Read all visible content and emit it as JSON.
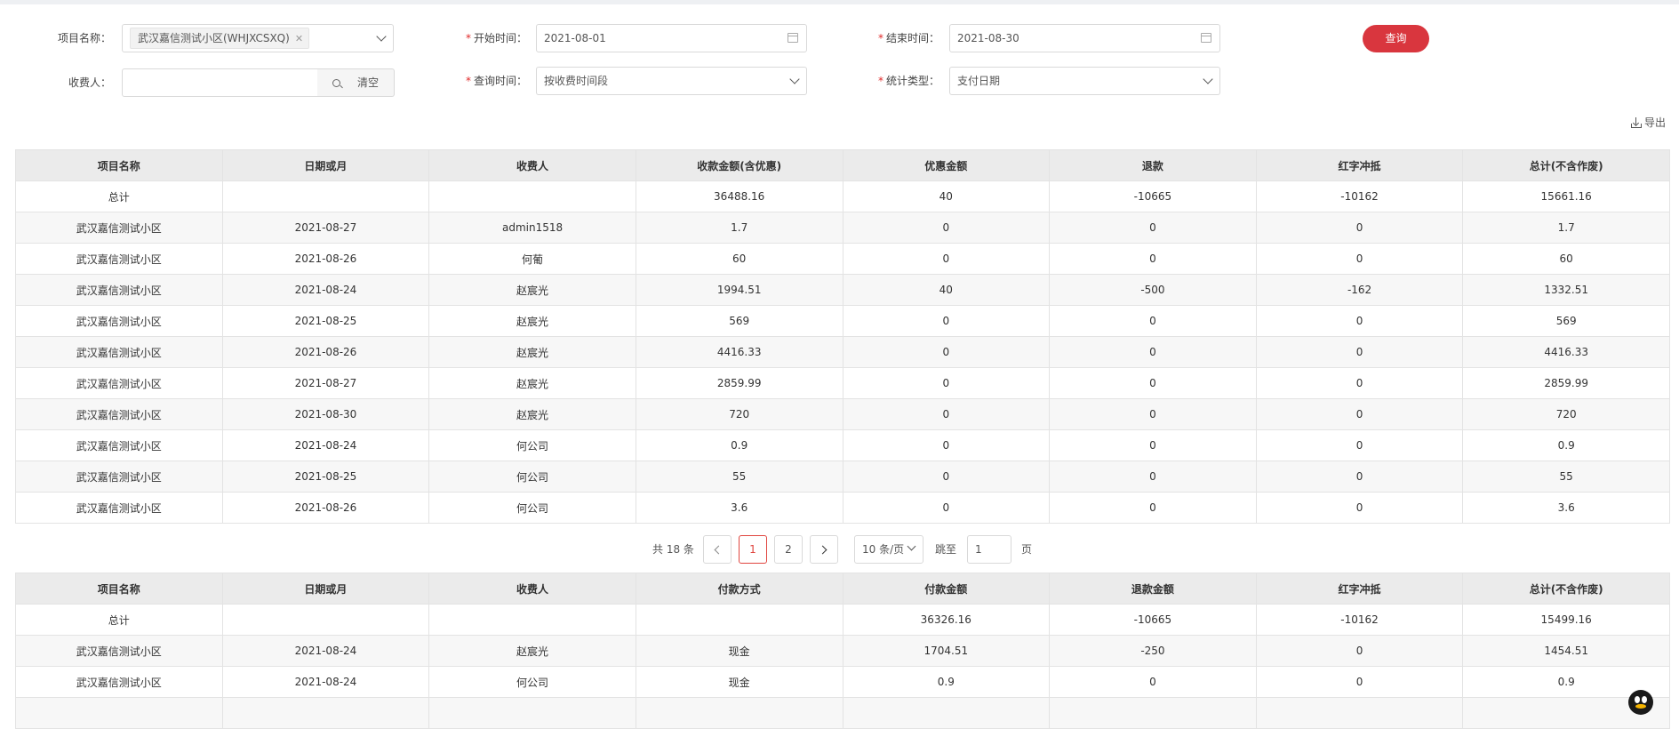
{
  "filters": {
    "project_label": "项目名称：",
    "project_tag": "武汉嘉信测试小区(WHJXCSXQ)",
    "start_label": "开始时间：",
    "start_value": "2021-08-01",
    "end_label": "结束时间：",
    "end_value": "2021-08-30",
    "payee_label": "收费人：",
    "payee_value": "",
    "clear_label": "清空",
    "query_time_label": "查询时间：",
    "query_time_value": "按收费时间段",
    "stat_type_label": "统计类型：",
    "stat_type_value": "支付日期",
    "required_mark": "*"
  },
  "query_button": "查询",
  "export_label": "导出",
  "table1": {
    "headers": [
      "项目名称",
      "日期或月",
      "收费人",
      "收款金额(含优惠)",
      "优惠金额",
      "退款",
      "红字冲抵",
      "总计(不含作废)"
    ],
    "rows": [
      [
        "总计",
        "",
        "",
        "36488.16",
        "40",
        "-10665",
        "-10162",
        "15661.16"
      ],
      [
        "武汉嘉信测试小区",
        "2021-08-27",
        "admin1518",
        "1.7",
        "0",
        "0",
        "0",
        "1.7"
      ],
      [
        "武汉嘉信测试小区",
        "2021-08-26",
        "何葡",
        "60",
        "0",
        "0",
        "0",
        "60"
      ],
      [
        "武汉嘉信测试小区",
        "2021-08-24",
        "赵宸光",
        "1994.51",
        "40",
        "-500",
        "-162",
        "1332.51"
      ],
      [
        "武汉嘉信测试小区",
        "2021-08-25",
        "赵宸光",
        "569",
        "0",
        "0",
        "0",
        "569"
      ],
      [
        "武汉嘉信测试小区",
        "2021-08-26",
        "赵宸光",
        "4416.33",
        "0",
        "0",
        "0",
        "4416.33"
      ],
      [
        "武汉嘉信测试小区",
        "2021-08-27",
        "赵宸光",
        "2859.99",
        "0",
        "0",
        "0",
        "2859.99"
      ],
      [
        "武汉嘉信测试小区",
        "2021-08-30",
        "赵宸光",
        "720",
        "0",
        "0",
        "0",
        "720"
      ],
      [
        "武汉嘉信测试小区",
        "2021-08-24",
        "何公司",
        "0.9",
        "0",
        "0",
        "0",
        "0.9"
      ],
      [
        "武汉嘉信测试小区",
        "2021-08-25",
        "何公司",
        "55",
        "0",
        "0",
        "0",
        "55"
      ],
      [
        "武汉嘉信测试小区",
        "2021-08-26",
        "何公司",
        "3.6",
        "0",
        "0",
        "0",
        "3.6"
      ]
    ]
  },
  "pagination": {
    "total_text": "共 18 条",
    "pages": [
      "1",
      "2"
    ],
    "current_page": "1",
    "page_size": "10 条/页",
    "jump_label": "跳至",
    "jump_value": "1",
    "page_suffix": "页"
  },
  "table2": {
    "headers": [
      "项目名称",
      "日期或月",
      "收费人",
      "付款方式",
      "付款金额",
      "退款金额",
      "红字冲抵",
      "总计(不含作废)"
    ],
    "rows": [
      [
        "总计",
        "",
        "",
        "",
        "36326.16",
        "-10665",
        "-10162",
        "15499.16"
      ],
      [
        "武汉嘉信测试小区",
        "2021-08-24",
        "赵宸光",
        "现金",
        "1704.51",
        "-250",
        "0",
        "1454.51"
      ],
      [
        "武汉嘉信测试小区",
        "2021-08-24",
        "何公司",
        "现金",
        "0.9",
        "0",
        "0",
        "0.9"
      ],
      [
        "",
        "",
        "",
        "",
        "",
        "",
        "",
        ""
      ]
    ]
  },
  "colors": {
    "accent": "#d9363e",
    "header_bg": "#ebebeb",
    "border": "#e3e3e3"
  },
  "icons": {
    "dropdown": "chevron-down-icon",
    "date": "calendar-icon",
    "search": "search-icon",
    "export": "download-icon",
    "chat": "qq-icon"
  }
}
